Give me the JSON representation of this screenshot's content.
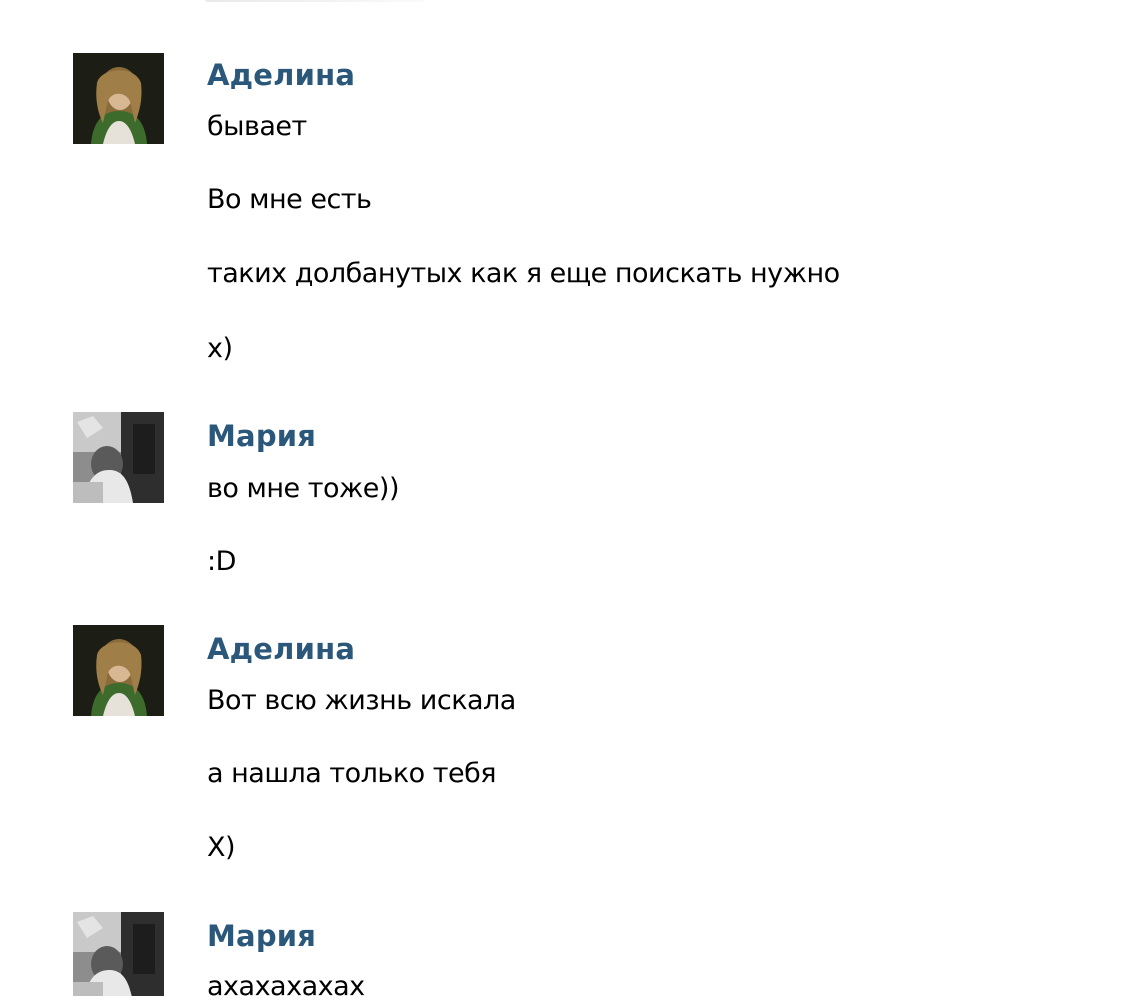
{
  "messages": [
    {
      "author": "Аделина",
      "avatar_icon": "avatar-adelina-icon",
      "lines": [
        "бывает",
        "Во мне есть",
        "таких долбанутых как я еще поискать нужно",
        "х)"
      ]
    },
    {
      "author": "Мария",
      "avatar_icon": "avatar-maria-icon",
      "lines": [
        "во мне тоже))",
        ":D"
      ]
    },
    {
      "author": "Аделина",
      "avatar_icon": "avatar-adelina-icon",
      "lines": [
        "Вот всю жизнь искала",
        "а нашла только тебя",
        "Х)"
      ]
    },
    {
      "author": "Мария",
      "avatar_icon": "avatar-maria-icon",
      "lines": [
        "ахахахахах"
      ]
    }
  ],
  "colors": {
    "author": "#2b587a",
    "text": "#000000",
    "background": "#ffffff"
  }
}
